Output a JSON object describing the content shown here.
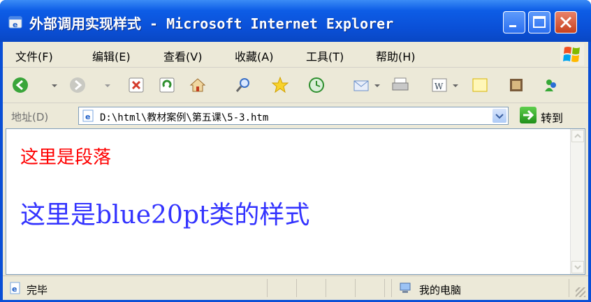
{
  "window": {
    "title": "外部调用实现样式 - Microsoft Internet Explorer"
  },
  "menubar": {
    "items": [
      "文件(F)",
      "编辑(E)",
      "查看(V)",
      "收藏(A)",
      "工具(T)",
      "帮助(H)"
    ]
  },
  "addressbar": {
    "label": "地址(D)",
    "value": "D:\\html\\教材案例\\第五课\\5-3.htm",
    "go_label": "转到"
  },
  "content": {
    "paragraph": "这里是段落",
    "blue_text": "这里是blue20pt类的样式",
    "paragraph_color": "#ff0000",
    "blue_color": "#3333ff"
  },
  "status": {
    "text": "完毕",
    "zone": "我的电脑"
  },
  "colors": {
    "title_blue": "#0a4fd6",
    "frame": "#ece9d8",
    "close_red": "#c7411e"
  }
}
